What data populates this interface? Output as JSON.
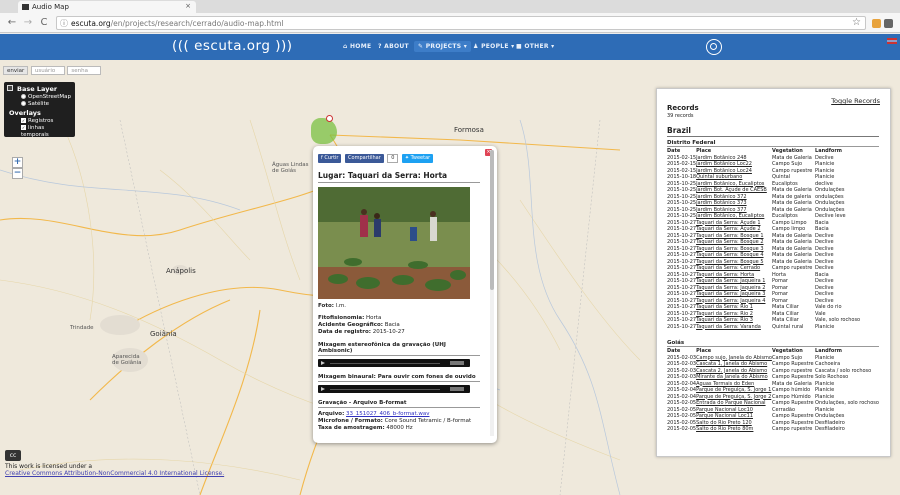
{
  "browser": {
    "tab_title": "Audio Map",
    "tab_close": "×",
    "url_domain": "escuta.org",
    "url_path": "/en/projects/research/cerrado/audio-map.html",
    "info_icon": "ⓘ",
    "star_icon": "☆",
    "back_icon": "←",
    "forward_icon": "→",
    "reload_icon": "C"
  },
  "site": {
    "brand": "((( escuta.org )))",
    "nav": {
      "home": "⌂ HOME",
      "about": "? ABOUT",
      "projects": "✎ PROJECTS ▾",
      "people": "♟ PEOPLE ▾",
      "other": "■ OTHER ▾"
    }
  },
  "map": {
    "send_button": "enviar",
    "field1_placeholder": "usuário",
    "field2_placeholder": "senha",
    "layers": {
      "base_heading": "Base Layer",
      "base_options": [
        "OpenStreetMap",
        "Satélite"
      ],
      "overlay_heading": "Overlays",
      "overlay_options": [
        "Registros",
        "linhas temporais"
      ]
    },
    "zoom_in": "+",
    "zoom_out": "−",
    "cities": {
      "formosa": "Formosa",
      "aguas_lindas": "Águas Lindas\nde Goiás",
      "goiania": "Goiânia",
      "anapolis": "Anápolis",
      "trindade": "Trindade",
      "aparecida": "Aparecida\nde Goiânia"
    },
    "license_badge": "cc",
    "license_text": "This work is licensed under a",
    "license_link": "Creative Commons Attribution-NonCommercial 4.0 International License."
  },
  "popup": {
    "close": "×",
    "share": {
      "curtir": "f Curtir",
      "compartilhar": "Compartilhar",
      "count": "0",
      "tweetar": "✦ Tweetar"
    },
    "title": "Lugar: Taquari da Serra: Horta",
    "foto_label": "Foto:",
    "foto_value": "l.m.",
    "fitofisionomia_label": "Fitofisionomia:",
    "fitofisionomia_value": "Horta",
    "acidente_label": "Acidente Geográfico:",
    "acidente_value": "Bacia",
    "data_label": "Data de registro:",
    "data_value": "2015-10-27",
    "sec_stereo": "Mixagem estereofônica da gravação (UHJ Ambisonic)",
    "sec_binaural": "Mixagem binaural: Para ouvir com fones de ouvido",
    "sec_bformat": "Gravação - Arquivo B-format",
    "arquivo_label": "Arquivo:",
    "arquivo_value": "33_151027_406_b-format.wav",
    "microfone_label": "Microfone / Formato:",
    "microfone_value": "Core Sound Tetramic / B-format",
    "taxa_label": "Taxa de amostragem:",
    "taxa_value": "48000 Hz"
  },
  "records": {
    "toggle": "Toggle Records",
    "title": "Records",
    "count": "39 records",
    "country": "Brazil",
    "columns": [
      "Date",
      "Place",
      "Vegetation",
      "Landform"
    ],
    "regions": [
      {
        "name": "Distrito Federal",
        "rows": [
          [
            "2015-02-15",
            "Jardim Botânico 248",
            "Mata de Galeria",
            "Declive"
          ],
          [
            "2015-02-15",
            "Jardim Botânico Loc22",
            "Campo Sujo",
            "Planície"
          ],
          [
            "2015-02-15",
            "Jardim Botânico Loc24",
            "Campo rupestre",
            "Planície"
          ],
          [
            "2015-10-18",
            "Quintal suburbano",
            "Quintal",
            "Planície"
          ],
          [
            "2015-10-25",
            "Jardim Botânico, Eucaliptos",
            "Eucaliptos",
            "declive"
          ],
          [
            "2015-10-25",
            "Jardim Bot. Açude de CAESB",
            "Mata de Galeria",
            "Ondulações"
          ],
          [
            "2015-10-25",
            "Jardim Botânico 372",
            "Mata de galeria",
            "ondulações"
          ],
          [
            "2015-10-25",
            "Jardim Botânico 373",
            "Mata de Galeria",
            "Ondulações"
          ],
          [
            "2015-10-25",
            "Jardim Botânico 377",
            "Mata de Galeria",
            "Ondulações"
          ],
          [
            "2015-10-25",
            "Jardim Botânico, Eucaliptos",
            "Eucaliptos",
            "Declive leve"
          ],
          [
            "2015-10-27",
            "Taquari da Serra: Açude 1",
            "Campo Limpo",
            "Bacia"
          ],
          [
            "2015-10-27",
            "Taquari da Serra: Açude 2",
            "Campo limpo",
            "Bacia"
          ],
          [
            "2015-10-27",
            "Taquari da Serra: Bosque 1",
            "Mata de Galeria",
            "Declive"
          ],
          [
            "2015-10-27",
            "Taquari da Serra: Bosque 2",
            "Mata de Galeria",
            "Declive"
          ],
          [
            "2015-10-27",
            "Taquari da Serra: Bosque 3",
            "Mata de Galeria",
            "Declive"
          ],
          [
            "2015-10-27",
            "Taquari da Serra: Bosque 4",
            "Mata de Galeria",
            "Declive"
          ],
          [
            "2015-10-27",
            "Taquari da Serra: Bosque 5",
            "Mata de Galeria",
            "Declive"
          ],
          [
            "2015-10-27",
            "Taquari da Serra: Cerrado",
            "Campo rupestre",
            "Declive"
          ],
          [
            "2015-10-27",
            "Taquari da Serra: Horta",
            "Horta",
            "Bacia"
          ],
          [
            "2015-10-27",
            "Taquari da Serra: Jaqueira 1",
            "Pomar",
            "Declive"
          ],
          [
            "2015-10-27",
            "Taquari da Serra: Jaqueira 2",
            "Pomar",
            "Declive"
          ],
          [
            "2015-10-27",
            "Taquari da Serra: Jaqueira 3",
            "Pomar",
            "Declive"
          ],
          [
            "2015-10-27",
            "Taquari da Serra: Jaqueira 4",
            "Pomar",
            "Declive"
          ],
          [
            "2015-10-27",
            "Taquari da Serra: Rio 1",
            "Mata Ciliar",
            "Vale do rio"
          ],
          [
            "2015-10-27",
            "Taquari da Serra: Rio 2",
            "Mata Ciliar",
            "Vale"
          ],
          [
            "2015-10-27",
            "Taquari da Serra: Rio 3",
            "Mata Ciliar",
            "Vale, solo rochoso"
          ],
          [
            "2015-10-27",
            "Taquari da Serra: Varanda",
            "Quintal rural",
            "Planície"
          ]
        ]
      },
      {
        "name": "Goiás",
        "rows": [
          [
            "2015-02-03",
            "Campo sujo, Janela do Abismo",
            "Campo Sujo",
            "Planície"
          ],
          [
            "2015-02-03",
            "Cascata 1, Janela do Abismo",
            "Campo Rupestre",
            "Cachoeira"
          ],
          [
            "2015-02-03",
            "Cascata 2, Janela do Abismo",
            "Campo rupestre",
            "Cascata / solo rochoso"
          ],
          [
            "2015-02-03",
            "Mirante da Janela do Abismo",
            "Campo Rupestre",
            "Solo Rochoso"
          ],
          [
            "2015-02-04",
            "Aguas Termais do Éden",
            "Mata de Galeria",
            "Planície"
          ],
          [
            "2015-02-04",
            "Parque de Preguiça, S. Jorge 1",
            "Campo húmido",
            "Planície"
          ],
          [
            "2015-02-04",
            "Parque de Preguiça, S. Jorge 2",
            "Campo Húmido",
            "Planície"
          ],
          [
            "2015-02-05",
            "Entrada do Parque Nacional",
            "Campo Rupestre",
            "Ondulações, solo rochoso"
          ],
          [
            "2015-02-05",
            "Parque Nacional Loc10",
            "Cerradão",
            "Planície"
          ],
          [
            "2015-02-05",
            "Parque Nacional Loc11",
            "Campo Rupestre",
            "Ondulações"
          ],
          [
            "2015-02-05",
            "Salto do Rio Preto 120",
            "Campo Rupestre",
            "Desfiladeiro"
          ],
          [
            "2015-02-05",
            "Salto do Rio Preto 80m",
            "Campo rupestre",
            "Desfiladeiro"
          ]
        ]
      }
    ]
  },
  "colors": {
    "nav_blue": "#2e6cb6",
    "marker_red": "#cc3333",
    "area_green": "#7bc043"
  }
}
